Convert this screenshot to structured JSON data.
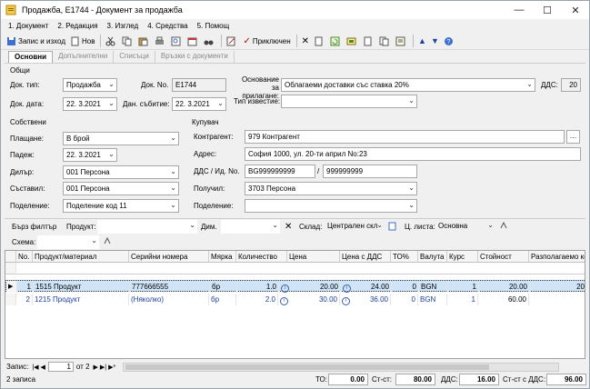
{
  "window": {
    "title": "Продажба, E1744 - Документ за продажба",
    "minimize": "—",
    "maximize": "☐",
    "close": "✕"
  },
  "menu": [
    "1. Документ",
    "2. Редакция",
    "3. Изглед",
    "4. Средства",
    "5. Помощ"
  ],
  "toolbar": {
    "save_exit": "Запис и изход",
    "new": "Нов",
    "applied": "Приключен"
  },
  "tabs": [
    "Основни",
    "Допълнителни",
    "Списъци",
    "Връзки с документи"
  ],
  "general": {
    "group": "Общи",
    "doc_type_label": "Док. тип:",
    "doc_type": "Продажба",
    "doc_date_label": "Док. дата:",
    "doc_date": "22. 3.2021",
    "doc_no_label": "Док. No.",
    "doc_no": "E1744",
    "event_date_label": "Дан. събитие:",
    "event_date": "22. 3.2021",
    "basis_label": "Основание\nза прилагане:",
    "basis": "Облагаеми доставки със ставка 20%",
    "vat_label": "ДДС:",
    "vat": "20",
    "notice_label": "Тип известие:",
    "notice": ""
  },
  "own": {
    "group": "Собствени",
    "payment_label": "Плащане:",
    "payment": "В брой",
    "due_label": "Падеж:",
    "due": "22. 3.2021",
    "dealer_label": "Дилър:",
    "dealer": "001 Персона",
    "author_label": "Съставил:",
    "author": "001 Персона",
    "division_label": "Поделение:",
    "division": "Поделение код 11"
  },
  "buyer": {
    "group": "Купувач",
    "partner_label": "Контрагент:",
    "partner": "979 Контрагент",
    "address_label": "Адрес:",
    "address": "София 1000, ул. 20-ти април No:23",
    "vatid_label": "ДДС / Ид. No.",
    "vatno": "BG999999999",
    "idno": "999999999",
    "receiver_label": "Получил:",
    "receiver": "3703 Персона",
    "division_label": "Поделение:",
    "division": ""
  },
  "filter": {
    "quick": "Бърз филтър",
    "product_label": "Продукт:",
    "dim_label": "Дим.",
    "store_label": "Склад:",
    "store": "Централен скл",
    "pricelist_label": "Ц. листа:",
    "pricelist": "Основна",
    "schema_label": "Схема:"
  },
  "grid": {
    "columns": [
      "No.",
      "Продукт/материал",
      "Серийни номера",
      "Мярка",
      "Количество",
      "Цена",
      "Цена с ДДС",
      "ТО%",
      "Валута",
      "Курс",
      "Стойност",
      "Разполагаемо ко"
    ],
    "rows": [
      {
        "no": "1",
        "product": "1515 Продукт",
        "serial": "777666555",
        "unit": "бр",
        "qty": "1.0",
        "price": "20.00",
        "price_vat": "24.00",
        "to": "0",
        "cur": "BGN",
        "rate": "1",
        "value": "20.00",
        "avail": "20"
      },
      {
        "no": "2",
        "product": "1215 Продукт",
        "serial": "(Няколко)",
        "unit": "бр",
        "qty": "2.0",
        "price": "30.00",
        "price_vat": "36.00",
        "to": "0",
        "cur": "BGN",
        "rate": "1",
        "value": "60.00",
        "avail": ""
      }
    ]
  },
  "nav": {
    "label": "Запис:",
    "current": "1",
    "of": "от 2"
  },
  "status": {
    "records": "2 записа",
    "to_label": "ТО:",
    "to": "0.00",
    "total_label": "Ст-ст:",
    "total": "80.00",
    "vat_label": "ДДС:",
    "vat": "16.00",
    "total_vat_label": "Ст-ст с ДДС:",
    "total_vat": "96.00"
  }
}
